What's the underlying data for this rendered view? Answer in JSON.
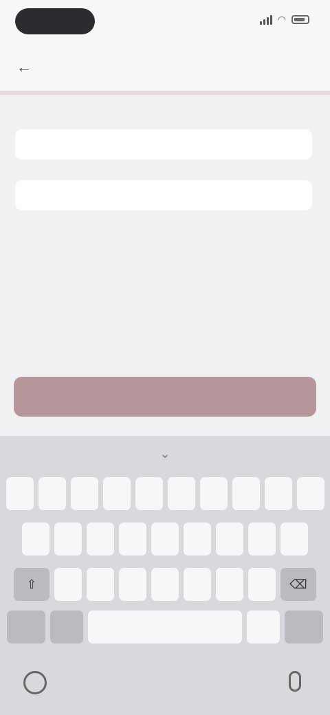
{
  "status_bar": {
    "time": "",
    "icons": [
      "signal-icon",
      "wifi-icon",
      "battery-icon"
    ]
  },
  "nav": {
    "back_icon": "back-arrow-icon",
    "title": ""
  },
  "form": {
    "section_title": "",
    "field1_label": "",
    "field1_placeholder": "",
    "field2_label": "",
    "field2_placeholder": "",
    "hint": ""
  },
  "primary_button": {
    "label": ""
  },
  "keyboard": {
    "toolbar_icon": "chevron-down-icon",
    "row1": [
      "",
      "",
      "",
      "",
      "",
      "",
      "",
      "",
      "",
      ""
    ],
    "row2": [
      "",
      "",
      "",
      "",
      "",
      "",
      "",
      "",
      ""
    ],
    "row3": [
      "",
      "",
      "",
      "",
      "",
      "",
      ""
    ],
    "row4": {
      "numbers": "",
      "emoji": "",
      "space": "",
      "period": "",
      "return": ""
    }
  },
  "colors": {
    "accent": "#b6959b",
    "background": "#f1f1f3"
  }
}
